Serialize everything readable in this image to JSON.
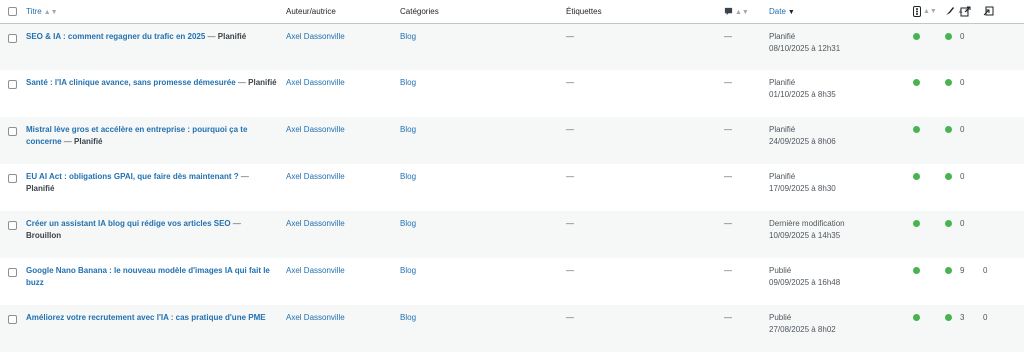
{
  "header": {
    "title": "Titre",
    "author": "Auteur/autrice",
    "categories": "Catégories",
    "tags": "Étiquettes",
    "date": "Date"
  },
  "colors": {
    "link": "#2271b1",
    "dot": "#46b450"
  },
  "icons": [
    "comment-icon",
    "seo-score-icon",
    "readability-icon",
    "outgoing-links-icon",
    "incoming-links-icon"
  ],
  "rows": [
    {
      "title": "SEO & IA : comment regagner du trafic en 2025",
      "state": "Planifié",
      "author": "Axel Dassonville",
      "category": "Blog",
      "tags": "—",
      "comments": "—",
      "date_status": "Planifié",
      "date": "08/10/2025 à 12h31",
      "links_out": "0",
      "links_in": ""
    },
    {
      "title": "Santé : l'IA clinique avance, sans promesse démesurée",
      "state": "Planifié",
      "author": "Axel Dassonville",
      "category": "Blog",
      "tags": "—",
      "comments": "—",
      "date_status": "Planifié",
      "date": "01/10/2025 à 8h35",
      "links_out": "0",
      "links_in": ""
    },
    {
      "title": "Mistral lève gros et accélère en entreprise : pourquoi ça te concerne",
      "state": "Planifié",
      "author": "Axel Dassonville",
      "category": "Blog",
      "tags": "—",
      "comments": "—",
      "date_status": "Planifié",
      "date": "24/09/2025 à 8h06",
      "links_out": "0",
      "links_in": ""
    },
    {
      "title": "EU AI Act : obligations GPAI, que faire dès maintenant ?",
      "state": "Planifié",
      "author": "Axel Dassonville",
      "category": "Blog",
      "tags": "—",
      "comments": "—",
      "date_status": "Planifié",
      "date": "17/09/2025 à 8h30",
      "links_out": "0",
      "links_in": ""
    },
    {
      "title": "Créer un assistant IA blog qui rédige vos articles SEO",
      "state": "Brouillon",
      "author": "Axel Dassonville",
      "category": "Blog",
      "tags": "—",
      "comments": "—",
      "date_status": "Dernière modification",
      "date": "10/09/2025 à 14h35",
      "links_out": "0",
      "links_in": ""
    },
    {
      "title": "Google Nano Banana : le nouveau modèle d'images IA qui fait le buzz",
      "state": "",
      "author": "Axel Dassonville",
      "category": "Blog",
      "tags": "—",
      "comments": "—",
      "date_status": "Publié",
      "date": "09/09/2025 à 16h48",
      "links_out": "9",
      "links_in": "0"
    },
    {
      "title": "Améliorez votre recrutement avec l'IA : cas pratique d'une PME",
      "state": "",
      "author": "Axel Dassonville",
      "category": "Blog",
      "tags": "—",
      "comments": "—",
      "date_status": "Publié",
      "date": "27/08/2025 à 8h02",
      "links_out": "3",
      "links_in": "0"
    }
  ]
}
